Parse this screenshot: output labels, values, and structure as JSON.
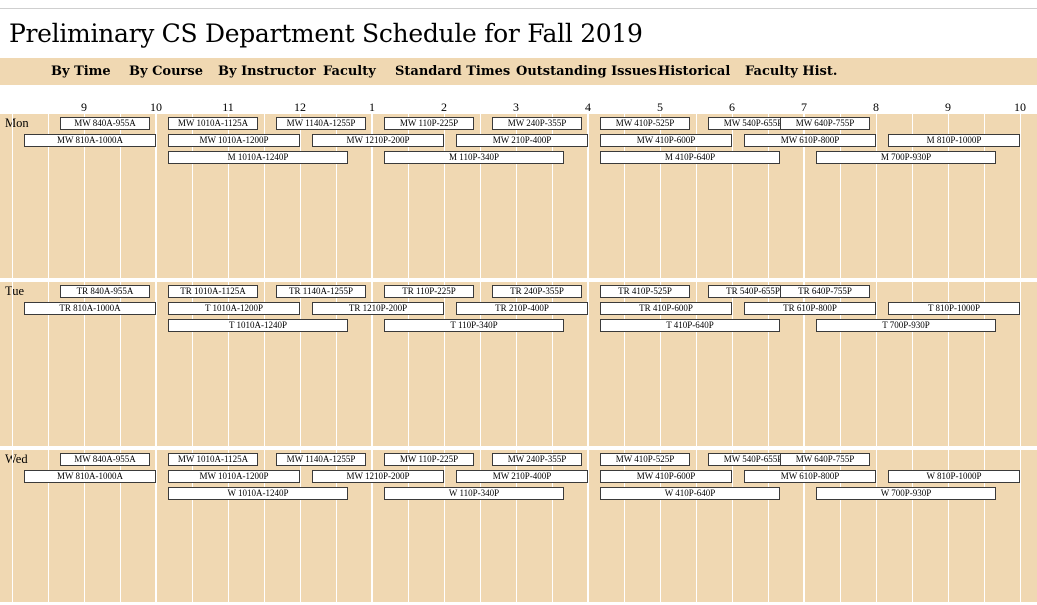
{
  "page": {
    "title": "Preliminary CS Department Schedule for Fall 2019"
  },
  "nav": [
    "By Time",
    "By Course",
    "By Instructor",
    "Faculty",
    "Standard Times",
    "Outstanding Issues",
    "Historical",
    "Faculty Hist."
  ],
  "hours": [
    "9",
    "10",
    "11",
    "12",
    "1",
    "2",
    "3",
    "4",
    "5",
    "6",
    "7",
    "8",
    "9",
    "10"
  ],
  "days": [
    {
      "label": "Mon",
      "rows": [
        [
          {
            "text": "MW 840A-955A",
            "start": "8:40",
            "end": "9:55"
          },
          {
            "text": "MW 1010A-1125A",
            "start": "10:10",
            "end": "11:25"
          },
          {
            "text": "MW 1140A-1255P",
            "start": "11:40",
            "end": "12:55"
          },
          {
            "text": "MW 110P-225P",
            "start": "13:10",
            "end": "14:25"
          },
          {
            "text": "MW 240P-355P",
            "start": "14:40",
            "end": "15:55"
          },
          {
            "text": "MW 410P-525P",
            "start": "16:10",
            "end": "17:25"
          },
          {
            "text": "MW 540P-655P",
            "start": "17:40",
            "end": "18:55"
          },
          {
            "text": "MW 640P-755P",
            "start": "18:40",
            "end": "19:55"
          }
        ],
        [
          {
            "text": "MW 810A-1000A",
            "start": "8:10",
            "end": "10:00"
          },
          {
            "text": "MW 1010A-1200P",
            "start": "10:10",
            "end": "12:00"
          },
          {
            "text": "MW 1210P-200P",
            "start": "12:10",
            "end": "14:00"
          },
          {
            "text": "MW 210P-400P",
            "start": "14:10",
            "end": "16:00"
          },
          {
            "text": "MW 410P-600P",
            "start": "16:10",
            "end": "18:00"
          },
          {
            "text": "MW 610P-800P",
            "start": "18:10",
            "end": "20:00"
          },
          {
            "text": "M 810P-1000P",
            "start": "20:10",
            "end": "22:00"
          }
        ],
        [
          {
            "text": "M 1010A-1240P",
            "start": "10:10",
            "end": "12:40"
          },
          {
            "text": "M 110P-340P",
            "start": "13:10",
            "end": "15:40"
          },
          {
            "text": "M 410P-640P",
            "start": "16:10",
            "end": "18:40"
          },
          {
            "text": "M 700P-930P",
            "start": "19:10",
            "end": "21:40"
          }
        ]
      ]
    },
    {
      "label": "Tue",
      "rows": [
        [
          {
            "text": "TR 840A-955A",
            "start": "8:40",
            "end": "9:55"
          },
          {
            "text": "TR 1010A-1125A",
            "start": "10:10",
            "end": "11:25"
          },
          {
            "text": "TR 1140A-1255P",
            "start": "11:40",
            "end": "12:55"
          },
          {
            "text": "TR 110P-225P",
            "start": "13:10",
            "end": "14:25"
          },
          {
            "text": "TR 240P-355P",
            "start": "14:40",
            "end": "15:55"
          },
          {
            "text": "TR 410P-525P",
            "start": "16:10",
            "end": "17:25"
          },
          {
            "text": "TR 540P-655P",
            "start": "17:40",
            "end": "18:55"
          },
          {
            "text": "TR 640P-755P",
            "start": "18:40",
            "end": "19:55"
          }
        ],
        [
          {
            "text": "TR 810A-1000A",
            "start": "8:10",
            "end": "10:00"
          },
          {
            "text": "T 1010A-1200P",
            "start": "10:10",
            "end": "12:00"
          },
          {
            "text": "TR 1210P-200P",
            "start": "12:10",
            "end": "14:00"
          },
          {
            "text": "TR 210P-400P",
            "start": "14:10",
            "end": "16:00"
          },
          {
            "text": "TR 410P-600P",
            "start": "16:10",
            "end": "18:00"
          },
          {
            "text": "TR 610P-800P",
            "start": "18:10",
            "end": "20:00"
          },
          {
            "text": "T 810P-1000P",
            "start": "20:10",
            "end": "22:00"
          }
        ],
        [
          {
            "text": "T 1010A-1240P",
            "start": "10:10",
            "end": "12:40"
          },
          {
            "text": "T 110P-340P",
            "start": "13:10",
            "end": "15:40"
          },
          {
            "text": "T 410P-640P",
            "start": "16:10",
            "end": "18:40"
          },
          {
            "text": "T 700P-930P",
            "start": "19:10",
            "end": "21:40"
          }
        ]
      ]
    },
    {
      "label": "Wed",
      "rows": [
        [
          {
            "text": "MW 840A-955A",
            "start": "8:40",
            "end": "9:55"
          },
          {
            "text": "MW 1010A-1125A",
            "start": "10:10",
            "end": "11:25"
          },
          {
            "text": "MW 1140A-1255P",
            "start": "11:40",
            "end": "12:55"
          },
          {
            "text": "MW 110P-225P",
            "start": "13:10",
            "end": "14:25"
          },
          {
            "text": "MW 240P-355P",
            "start": "14:40",
            "end": "15:55"
          },
          {
            "text": "MW 410P-525P",
            "start": "16:10",
            "end": "17:25"
          },
          {
            "text": "MW 540P-655P",
            "start": "17:40",
            "end": "18:55"
          },
          {
            "text": "MW 640P-755P",
            "start": "18:40",
            "end": "19:55"
          }
        ],
        [
          {
            "text": "MW 810A-1000A",
            "start": "8:10",
            "end": "10:00"
          },
          {
            "text": "MW 1010A-1200P",
            "start": "10:10",
            "end": "12:00"
          },
          {
            "text": "MW 1210P-200P",
            "start": "12:10",
            "end": "14:00"
          },
          {
            "text": "MW 210P-400P",
            "start": "14:10",
            "end": "16:00"
          },
          {
            "text": "MW 410P-600P",
            "start": "16:10",
            "end": "18:00"
          },
          {
            "text": "MW 610P-800P",
            "start": "18:10",
            "end": "20:00"
          },
          {
            "text": "W 810P-1000P",
            "start": "20:10",
            "end": "22:00"
          }
        ],
        [
          {
            "text": "W 1010A-1240P",
            "start": "10:10",
            "end": "12:40"
          },
          {
            "text": "W 110P-340P",
            "start": "13:10",
            "end": "15:40"
          },
          {
            "text": "W 410P-640P",
            "start": "16:10",
            "end": "18:40"
          },
          {
            "text": "W 700P-930P",
            "start": "19:10",
            "end": "21:40"
          }
        ]
      ]
    }
  ]
}
